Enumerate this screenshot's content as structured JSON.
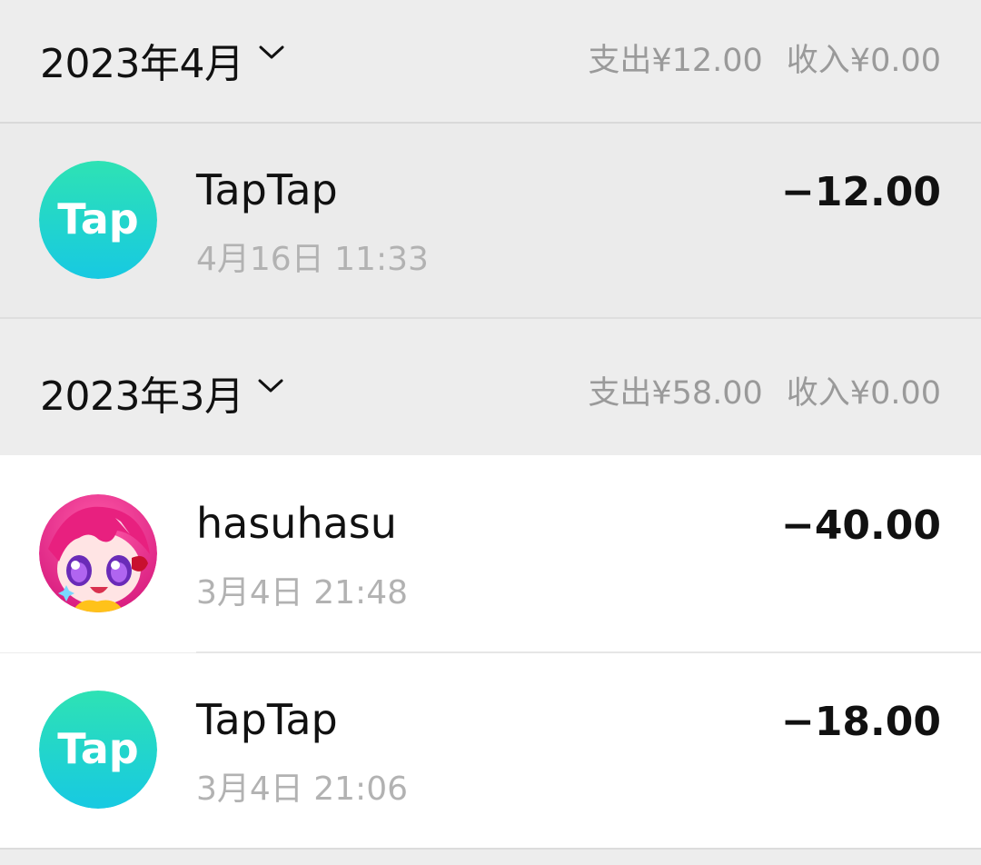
{
  "months": [
    {
      "title": "2023年4月",
      "summary_out": "支出¥12.00",
      "summary_in": "收入¥0.00"
    },
    {
      "title": "2023年3月",
      "summary_out": "支出¥58.00",
      "summary_in": "收入¥0.00"
    }
  ],
  "transactions": [
    {
      "name": "TapTap",
      "time": "4月16日 11:33",
      "amount": "−12.00",
      "avatar": "taptap-logo"
    },
    {
      "name": "hasuhasu",
      "time": "3月4日 21:48",
      "amount": "−40.00",
      "avatar": "anime-avatar"
    },
    {
      "name": "TapTap",
      "time": "3月4日 21:06",
      "amount": "−18.00",
      "avatar": "taptap-logo"
    }
  ],
  "logo_text": "Tap",
  "colors": {
    "page_bg": "#ededed",
    "row_highlight": "#ebebeb",
    "row_bg": "#ffffff",
    "taptap_gradient_top": "#2ee2b4",
    "taptap_gradient_bottom": "#1bcbe0"
  }
}
